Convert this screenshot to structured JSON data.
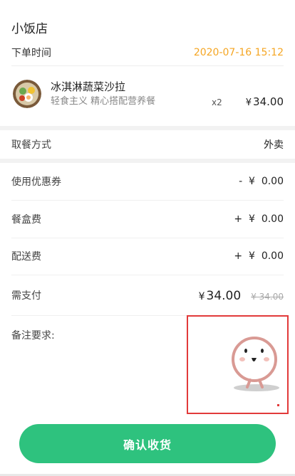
{
  "shop": {
    "name": "小饭店"
  },
  "order": {
    "time_label": "下单时间",
    "time_value": "2020-07-16 15:12"
  },
  "item": {
    "name": "冰淇淋蔬菜沙拉",
    "desc": "轻食主义 精心搭配营养餐",
    "qty": "x2",
    "price_symbol": "¥",
    "price": "34.00",
    "thumb_icon": "salad-food-icon"
  },
  "pickup": {
    "label": "取餐方式",
    "value": "外卖"
  },
  "fees": [
    {
      "label": "使用优惠券",
      "value": "-  ¥  0.00"
    },
    {
      "label": "餐盒费",
      "value": "+  ¥  0.00"
    },
    {
      "label": "配送费",
      "value": "+  ¥  0.00"
    }
  ],
  "payment": {
    "label": "需支付",
    "symbol": "¥",
    "amount": "34.00",
    "original": "¥ 34.00"
  },
  "note": {
    "label": "备注要求:",
    "mascot_icon": "smiley-mascot-icon"
  },
  "actions": {
    "confirm_label": "确认收货"
  },
  "colors": {
    "accent_green": "#2ec27e",
    "time_orange": "#f5a623",
    "highlight_red": "#e23a3a"
  }
}
